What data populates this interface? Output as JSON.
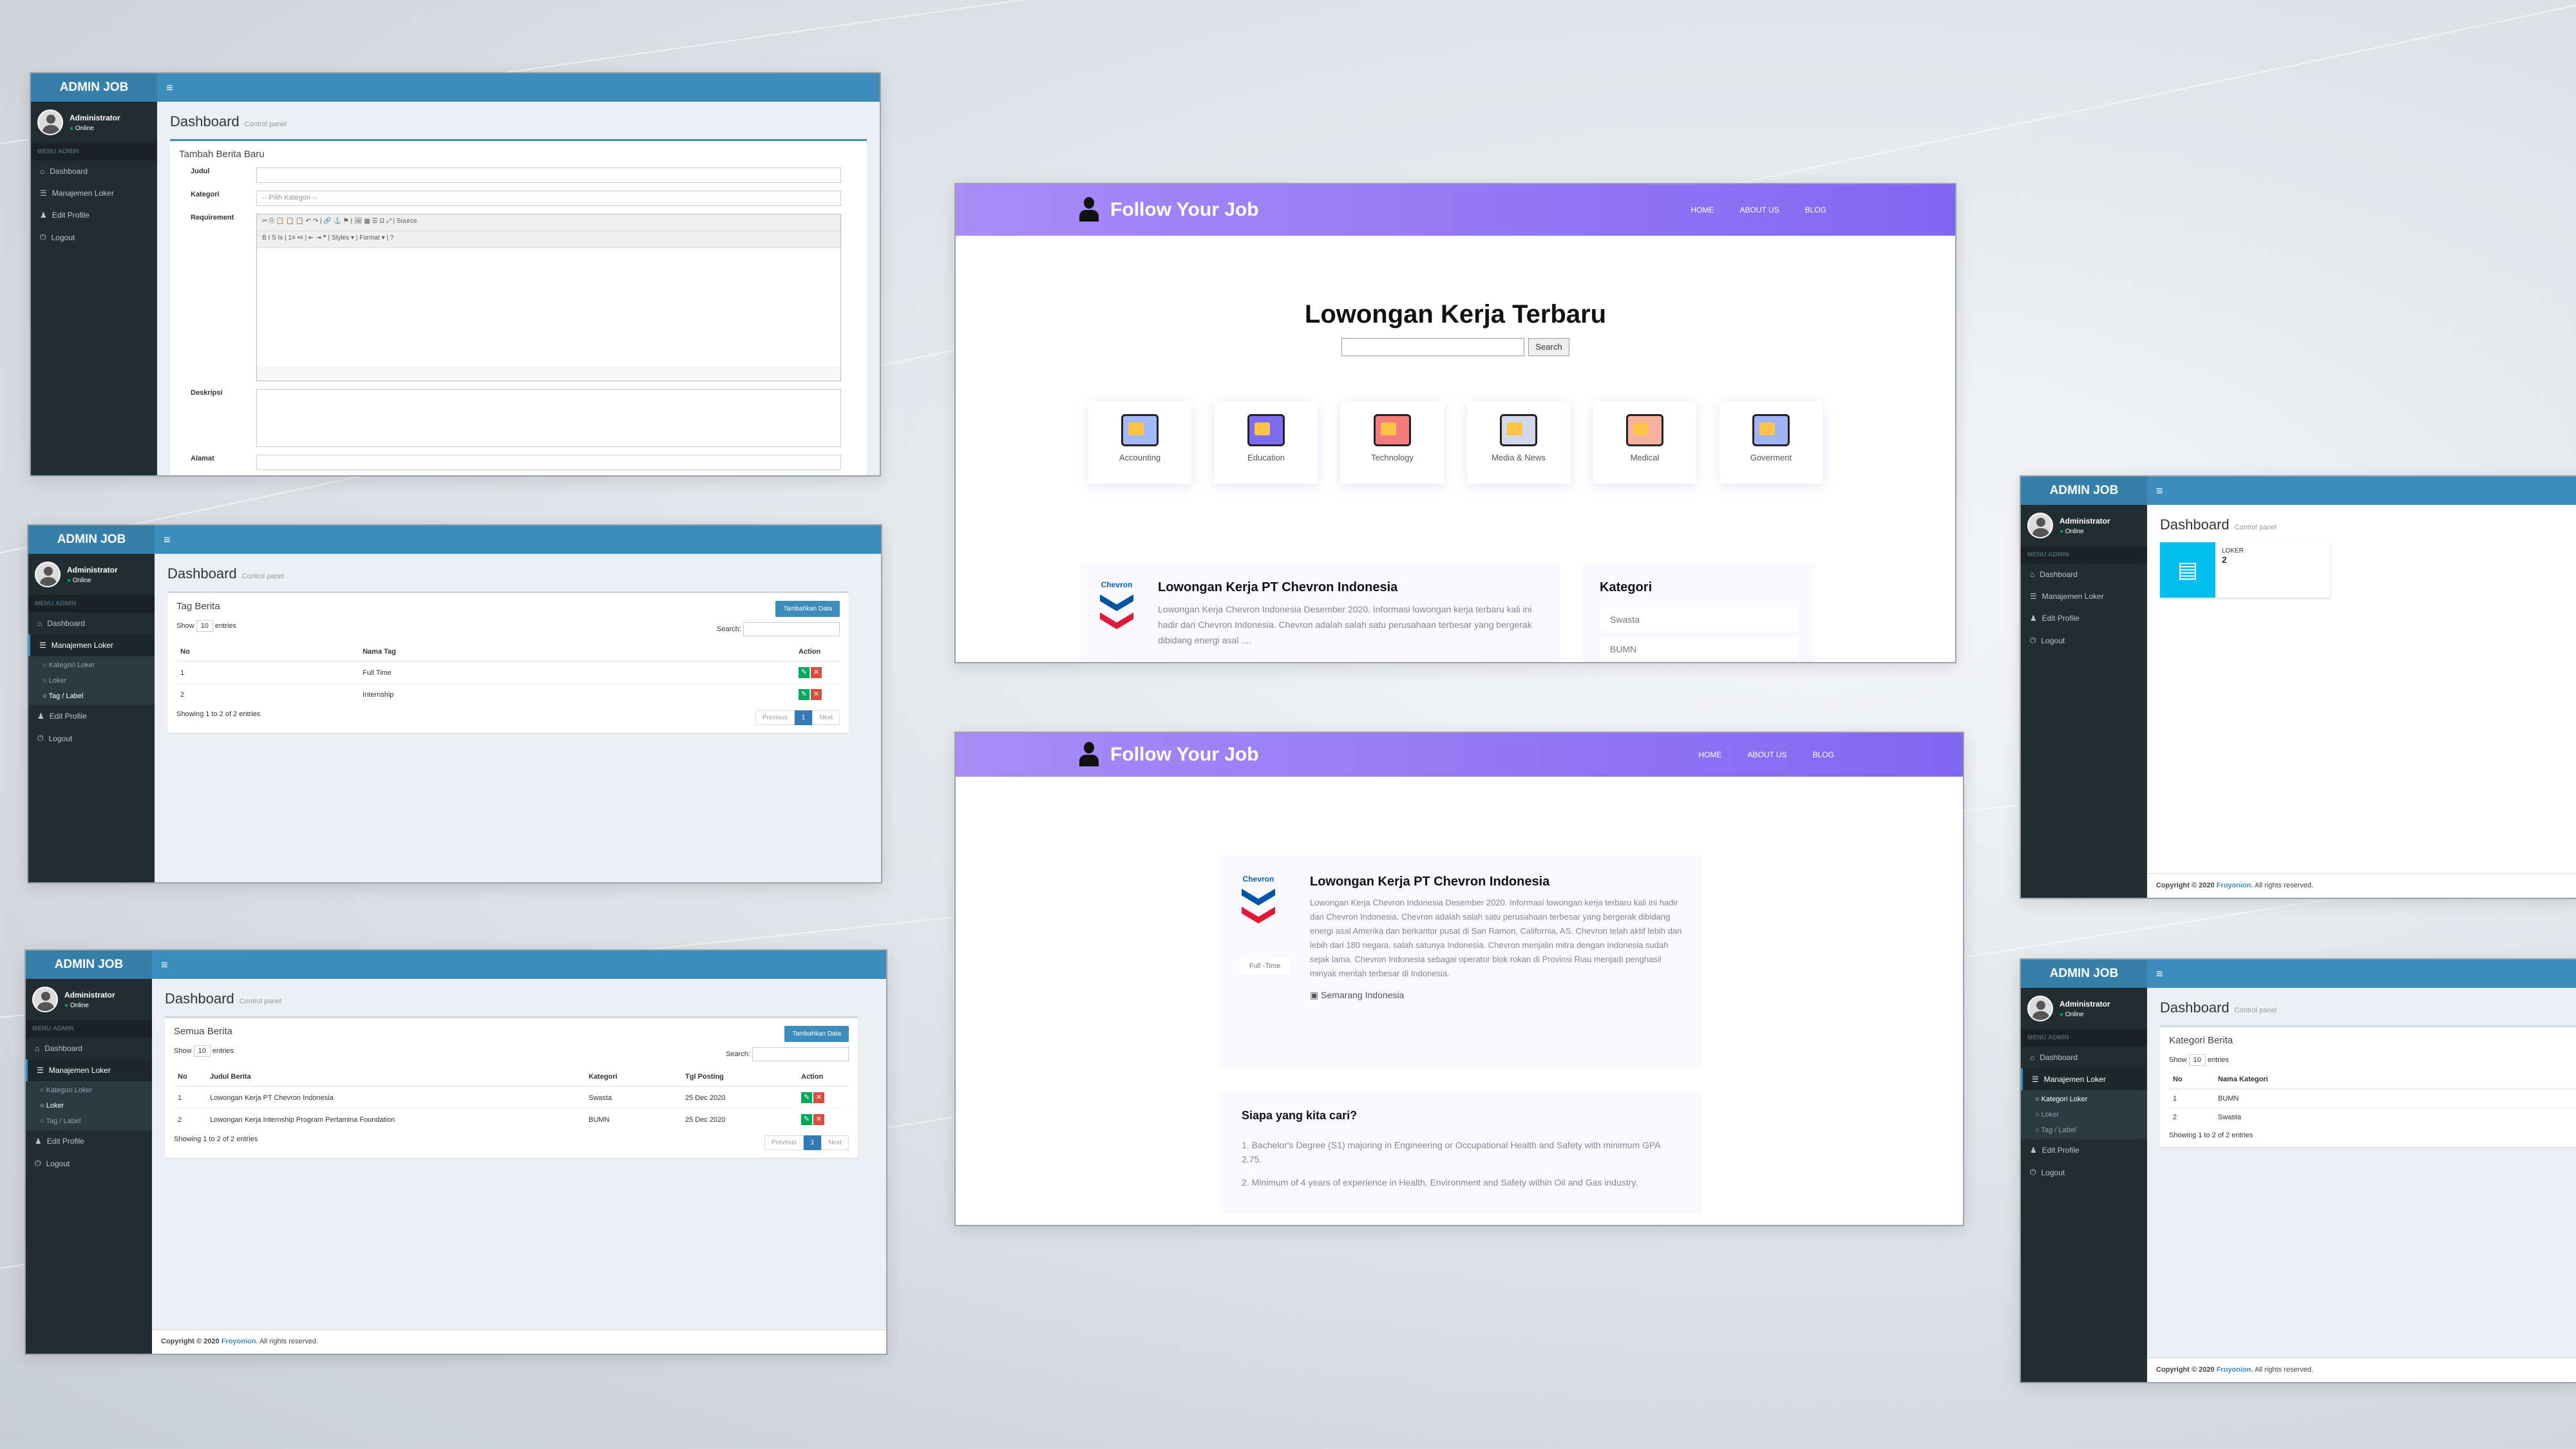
{
  "admin": {
    "brand": "ADMIN JOB",
    "menu_icon": "≡",
    "user_name": "Administrator",
    "user_status": "Online",
    "menu_header": "MENU ADMIN",
    "menu": {
      "dashboard": "Dashboard",
      "manajemen": "Manajemen Loker",
      "kategori": "Kategori Loker",
      "loker": "Loker",
      "tag": "Tag / Label",
      "edit": "Edit Profile",
      "logout": "Logout"
    },
    "page_title": "Dashboard",
    "page_subtitle": "Control panel",
    "show": "Show",
    "entries": "entries",
    "entries_value": "10",
    "search": "Search:",
    "previous": "Previous",
    "next": "Next",
    "page": "1",
    "footer_prefix": "Copyright © 2020 ",
    "footer_brand": "Froyonion.",
    "footer_suffix": " All rights reserved."
  },
  "form": {
    "box_title": "Tambah Berita Baru",
    "judul": "Judul",
    "kategori": "Kategori",
    "kategori_placeholder": "-- Pilih Kategori --",
    "requirement": "Requirement",
    "deskripsi": "Deskripsi",
    "alamat": "Alamat",
    "toolbar1": "✂ ⎘ 📋 📋 📋 ↶ ↷ | 🔗 ⚓ ⚑ | 🖼 ▦ ☰ Ω ⤢ | Source",
    "toolbar2": "B I S Ix | 1≡ •≡ | ⇤ ⇥ ❝ | Styles ▾ | Format ▾ | ?"
  },
  "tags": {
    "box_title": "Tag Berita",
    "add_btn": "Tambahkan Data",
    "headers": [
      "No",
      "Nama Tag",
      "Action"
    ],
    "rows": [
      [
        "1",
        "Full Time"
      ],
      [
        "2",
        "Internship"
      ]
    ],
    "showing": "Showing 1 to 2 of 2 entries"
  },
  "berita": {
    "box_title": "Semua Berita",
    "add_btn": "Tambahkan Data",
    "headers": [
      "No",
      "Judul Berita",
      "Kategori",
      "Tgl Posting",
      "Action"
    ],
    "rows": [
      [
        "1",
        "Lowongan Kerja PT Chevron Indonesia",
        "Swasta",
        "25 Dec 2020"
      ],
      [
        "2",
        "Lowongan Kerja Internship Program Pertamina Foundation",
        "BUMN",
        "25 Dec 2020"
      ]
    ],
    "showing": "Showing 1 to 2 of 2 entries"
  },
  "dash": {
    "tile_label": "LOKER",
    "tile_value": "2"
  },
  "katber": {
    "box_title": "Kategori Berita",
    "headers": [
      "No",
      "Nama Kategori"
    ],
    "rows": [
      [
        "1",
        "BUMN"
      ],
      [
        "2",
        "Swasta"
      ]
    ],
    "showing": "Showing 1 to 2 of 2 entries"
  },
  "site": {
    "brand": "Follow Your Job",
    "nav": [
      "HOME",
      "ABOUT US",
      "BLOG"
    ],
    "hero": "Lowongan Kerja Terbaru",
    "search_btn": "Search",
    "categories": [
      "Accounting",
      "Education",
      "Technology",
      "Media & News",
      "Medical",
      "Goverment"
    ],
    "job_title": "Lowongan Kerja PT Chevron Indonesia",
    "job_excerpt": "Lowongan Kerja Chevron Indonesia Desember 2020. Informasi lowongan kerja terbaru kali ini hadir dari Chevron Indonesia. Chevron adalah salah satu perusahaan terbesar yang bergerak dibidang energi asal ....",
    "kategori_title": "Kategori",
    "kategori_items": [
      "Swasta",
      "BUMN"
    ],
    "chevron": "Chevron"
  },
  "detail": {
    "job_title": "Lowongan Kerja PT Chevron Indonesia",
    "job_desc": "Lowongan Kerja Chevron Indonesia Desember 2020. Informasi lowongan kerja terbaru kali ini hadir dari Chevron Indonesia. Chevron adalah salah satu perusahaan terbesar yang bergerak dibidang energi asal Amerika dan berkantor pusat di San Ramon, California, AS. Chevron telah aktif lebih dari lebih dari 180 negara. salah satunya Indonesia. Chevron menjalin mitra dengan Indonesia sudah sejak lama. Chevron Indonesia sebagai operator blok rokan di Provinsi Riau menjadi penghasil minyak mentah terbesar di Indonesia.",
    "badge": "Full -Time",
    "location": "Semarang Indonesia",
    "who_title": "Siapa yang kita cari?",
    "req1": "1. Bachelor's Degree (S1) majoring in Engineering or Occupational Health and Safety with minimum GPA 2.75.",
    "req2": "2. Minimum of 4 years of experience in Health, Environment and Safety within Oil and Gas industry."
  }
}
